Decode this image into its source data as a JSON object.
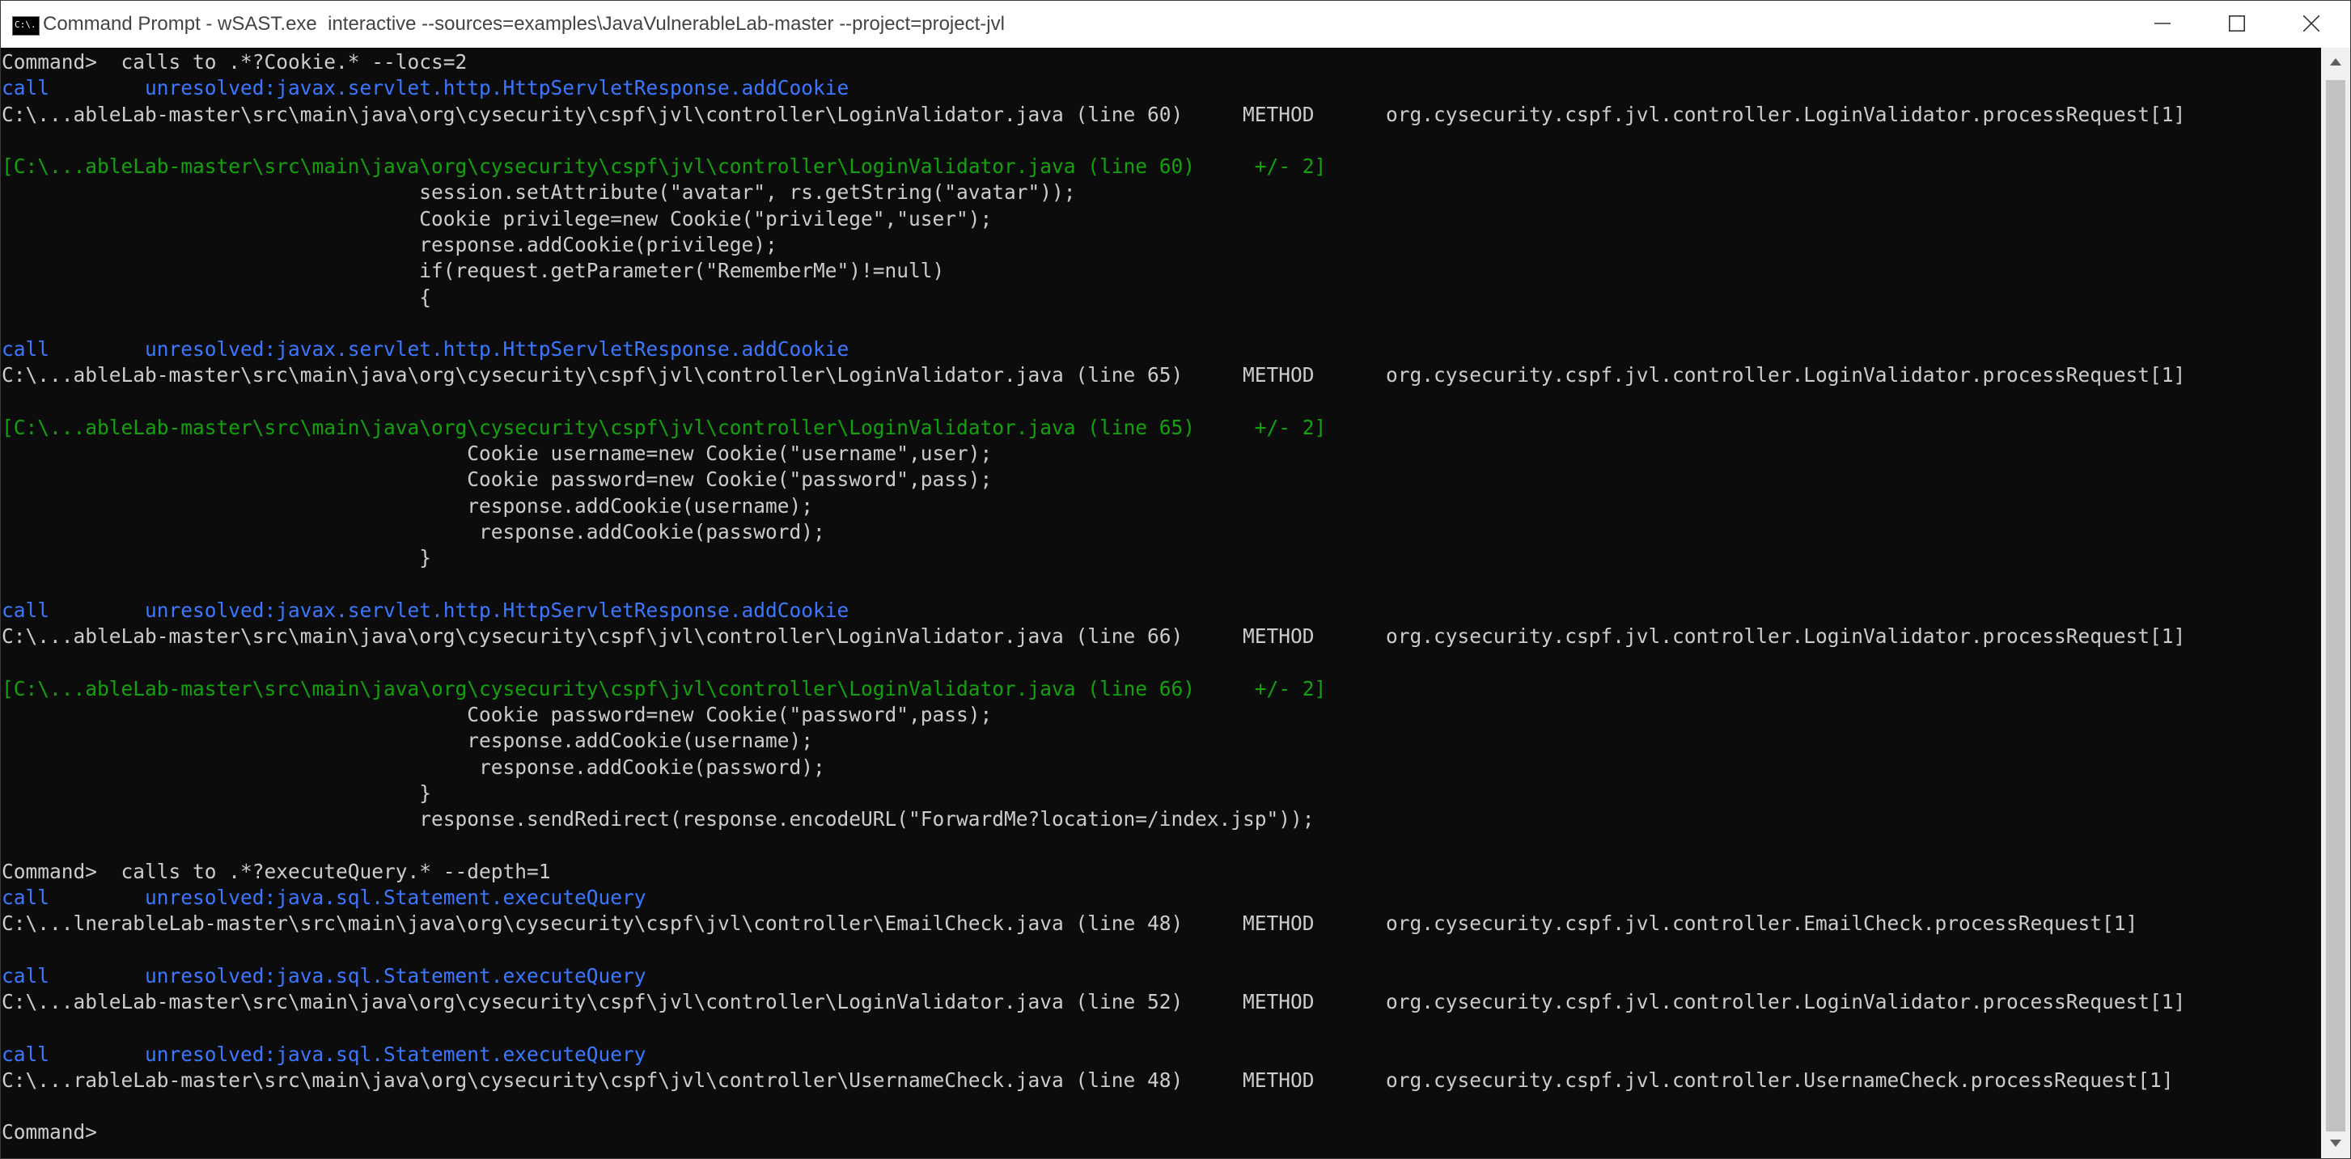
{
  "window": {
    "title": "Command Prompt - wSAST.exe  interactive --sources=examples\\JavaVulnerableLab-master --project=project-jvl",
    "icon_text": "C:\\."
  },
  "console": {
    "lines": [
      {
        "segments": [
          {
            "t": "Command>  calls to .*?Cookie.* --locs=2",
            "c": "default"
          }
        ]
      },
      {
        "segments": [
          {
            "t": "call        ",
            "c": "call"
          },
          {
            "t": "unresolved:javax.servlet.http.HttpServletResponse.addCookie",
            "c": "call"
          }
        ]
      },
      {
        "segments": [
          {
            "t": "C:\\...ableLab-master\\src\\main\\java\\org\\cysecurity\\cspf\\jvl\\controller\\LoginValidator.java (line 60)     METHOD      org.cysecurity.cspf.jvl.controller.LoginValidator.processRequest[1]",
            "c": "default"
          }
        ]
      },
      {
        "segments": []
      },
      {
        "segments": [
          {
            "t": "[C:\\...ableLab-master\\src\\main\\java\\org\\cysecurity\\cspf\\jvl\\controller\\LoginValidator.java (line 60)     +/- 2]",
            "c": "green"
          }
        ]
      },
      {
        "segments": [
          {
            "t": "                                   session.setAttribute(\"avatar\", rs.getString(\"avatar\"));",
            "c": "default"
          }
        ]
      },
      {
        "segments": [
          {
            "t": "                                   Cookie privilege=new Cookie(\"privilege\",\"user\");",
            "c": "default"
          }
        ]
      },
      {
        "segments": [
          {
            "t": "                                   response.addCookie(privilege);",
            "c": "default"
          }
        ]
      },
      {
        "segments": [
          {
            "t": "                                   if(request.getParameter(\"RememberMe\")!=null)",
            "c": "default"
          }
        ]
      },
      {
        "segments": [
          {
            "t": "                                   {",
            "c": "default"
          }
        ]
      },
      {
        "segments": []
      },
      {
        "segments": [
          {
            "t": "call        ",
            "c": "call"
          },
          {
            "t": "unresolved:javax.servlet.http.HttpServletResponse.addCookie",
            "c": "call"
          }
        ]
      },
      {
        "segments": [
          {
            "t": "C:\\...ableLab-master\\src\\main\\java\\org\\cysecurity\\cspf\\jvl\\controller\\LoginValidator.java (line 65)     METHOD      org.cysecurity.cspf.jvl.controller.LoginValidator.processRequest[1]",
            "c": "default"
          }
        ]
      },
      {
        "segments": []
      },
      {
        "segments": [
          {
            "t": "[C:\\...ableLab-master\\src\\main\\java\\org\\cysecurity\\cspf\\jvl\\controller\\LoginValidator.java (line 65)     +/- 2]",
            "c": "green"
          }
        ]
      },
      {
        "segments": [
          {
            "t": "                                       Cookie username=new Cookie(\"username\",user);",
            "c": "default"
          }
        ]
      },
      {
        "segments": [
          {
            "t": "                                       Cookie password=new Cookie(\"password\",pass);",
            "c": "default"
          }
        ]
      },
      {
        "segments": [
          {
            "t": "                                       response.addCookie(username);",
            "c": "default"
          }
        ]
      },
      {
        "segments": [
          {
            "t": "                                        response.addCookie(password);",
            "c": "default"
          }
        ]
      },
      {
        "segments": [
          {
            "t": "                                   }",
            "c": "default"
          }
        ]
      },
      {
        "segments": []
      },
      {
        "segments": [
          {
            "t": "call        ",
            "c": "call"
          },
          {
            "t": "unresolved:javax.servlet.http.HttpServletResponse.addCookie",
            "c": "call"
          }
        ]
      },
      {
        "segments": [
          {
            "t": "C:\\...ableLab-master\\src\\main\\java\\org\\cysecurity\\cspf\\jvl\\controller\\LoginValidator.java (line 66)     METHOD      org.cysecurity.cspf.jvl.controller.LoginValidator.processRequest[1]",
            "c": "default"
          }
        ]
      },
      {
        "segments": []
      },
      {
        "segments": [
          {
            "t": "[C:\\...ableLab-master\\src\\main\\java\\org\\cysecurity\\cspf\\jvl\\controller\\LoginValidator.java (line 66)     +/- 2]",
            "c": "green"
          }
        ]
      },
      {
        "segments": [
          {
            "t": "                                       Cookie password=new Cookie(\"password\",pass);",
            "c": "default"
          }
        ]
      },
      {
        "segments": [
          {
            "t": "                                       response.addCookie(username);",
            "c": "default"
          }
        ]
      },
      {
        "segments": [
          {
            "t": "                                        response.addCookie(password);",
            "c": "default"
          }
        ]
      },
      {
        "segments": [
          {
            "t": "                                   }",
            "c": "default"
          }
        ]
      },
      {
        "segments": [
          {
            "t": "                                   response.sendRedirect(response.encodeURL(\"ForwardMe?location=/index.jsp\"));",
            "c": "default"
          }
        ]
      },
      {
        "segments": []
      },
      {
        "segments": [
          {
            "t": "Command>  calls to .*?executeQuery.* --depth=1",
            "c": "default"
          }
        ]
      },
      {
        "segments": [
          {
            "t": "call        ",
            "c": "call"
          },
          {
            "t": "unresolved:java.sql.Statement.executeQuery",
            "c": "call"
          }
        ]
      },
      {
        "segments": [
          {
            "t": "C:\\...lnerableLab-master\\src\\main\\java\\org\\cysecurity\\cspf\\jvl\\controller\\EmailCheck.java (line 48)     METHOD      org.cysecurity.cspf.jvl.controller.EmailCheck.processRequest[1]",
            "c": "default"
          }
        ]
      },
      {
        "segments": []
      },
      {
        "segments": [
          {
            "t": "call        ",
            "c": "call"
          },
          {
            "t": "unresolved:java.sql.Statement.executeQuery",
            "c": "call"
          }
        ]
      },
      {
        "segments": [
          {
            "t": "C:\\...ableLab-master\\src\\main\\java\\org\\cysecurity\\cspf\\jvl\\controller\\LoginValidator.java (line 52)     METHOD      org.cysecurity.cspf.jvl.controller.LoginValidator.processRequest[1]",
            "c": "default"
          }
        ]
      },
      {
        "segments": []
      },
      {
        "segments": [
          {
            "t": "call        ",
            "c": "call"
          },
          {
            "t": "unresolved:java.sql.Statement.executeQuery",
            "c": "call"
          }
        ]
      },
      {
        "segments": [
          {
            "t": "C:\\...rableLab-master\\src\\main\\java\\org\\cysecurity\\cspf\\jvl\\controller\\UsernameCheck.java (line 48)     METHOD      org.cysecurity.cspf.jvl.controller.UsernameCheck.processRequest[1]",
            "c": "default"
          }
        ]
      },
      {
        "segments": []
      },
      {
        "segments": [
          {
            "t": "Command>",
            "c": "default"
          }
        ]
      }
    ]
  },
  "colors": {
    "background": "#0c0c0c",
    "default_text": "#cccccc",
    "call_blue": "#3b78ff",
    "snippet_green": "#13a10e",
    "titlebar_bg": "#ffffff"
  },
  "icons": {
    "minimize": "minimize-icon",
    "maximize": "maximize-icon",
    "close": "close-icon",
    "scroll_up": "scroll-up-arrow-icon",
    "scroll_down": "scroll-down-arrow-icon"
  }
}
